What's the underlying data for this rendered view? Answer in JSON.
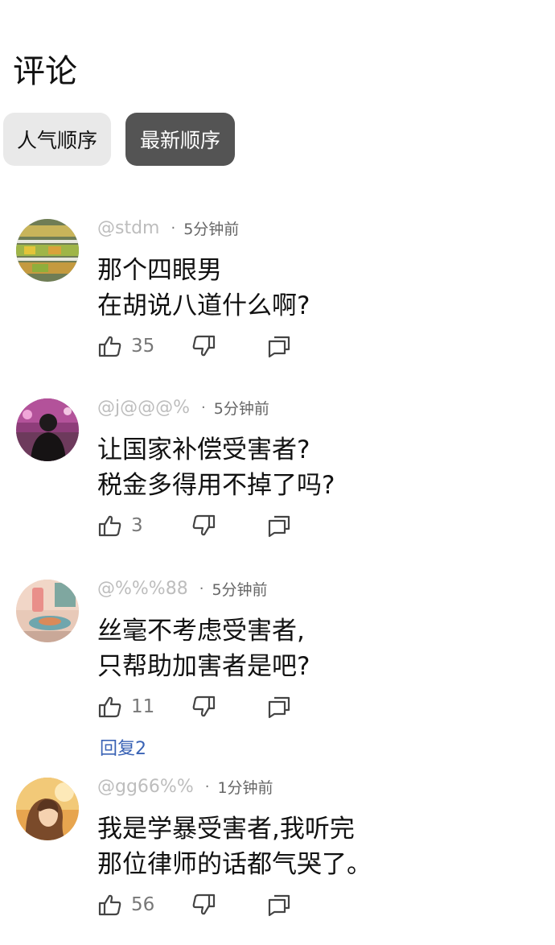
{
  "header": {
    "title": "评论"
  },
  "sort": {
    "popular_label": "人气顺序",
    "newest_label": "最新顺序",
    "active": "newest"
  },
  "comments": [
    {
      "user": "@stdm",
      "time": "5分钟前",
      "lines": [
        "那个四眼男",
        "在胡说八道什么啊?"
      ],
      "likes": "35",
      "replies_label": ""
    },
    {
      "user": "@j@@@%",
      "time": "5分钟前",
      "lines": [
        "让国家补偿受害者?",
        "税金多得用不掉了吗?"
      ],
      "likes": "3",
      "replies_label": ""
    },
    {
      "user": "@%%%88",
      "time": "5分钟前",
      "lines": [
        "丝毫不考虑受害者,",
        "只帮助加害者是吧?"
      ],
      "likes": "11",
      "replies_label": "回复2"
    },
    {
      "user": "@gg66%%",
      "time": "1分钟前",
      "lines": [
        "我是学暴受害者,我听完",
        "那位律师的话都气哭了。"
      ],
      "likes": "56",
      "replies_label": ""
    }
  ],
  "icons": {
    "like": "thumbs-up-icon",
    "dislike": "thumbs-down-icon",
    "reply": "reply-comment-icon"
  },
  "colors": {
    "active_sort_bg": "#545454",
    "inactive_sort_bg": "#e9e9e9",
    "reply_link": "#3a63b5"
  }
}
